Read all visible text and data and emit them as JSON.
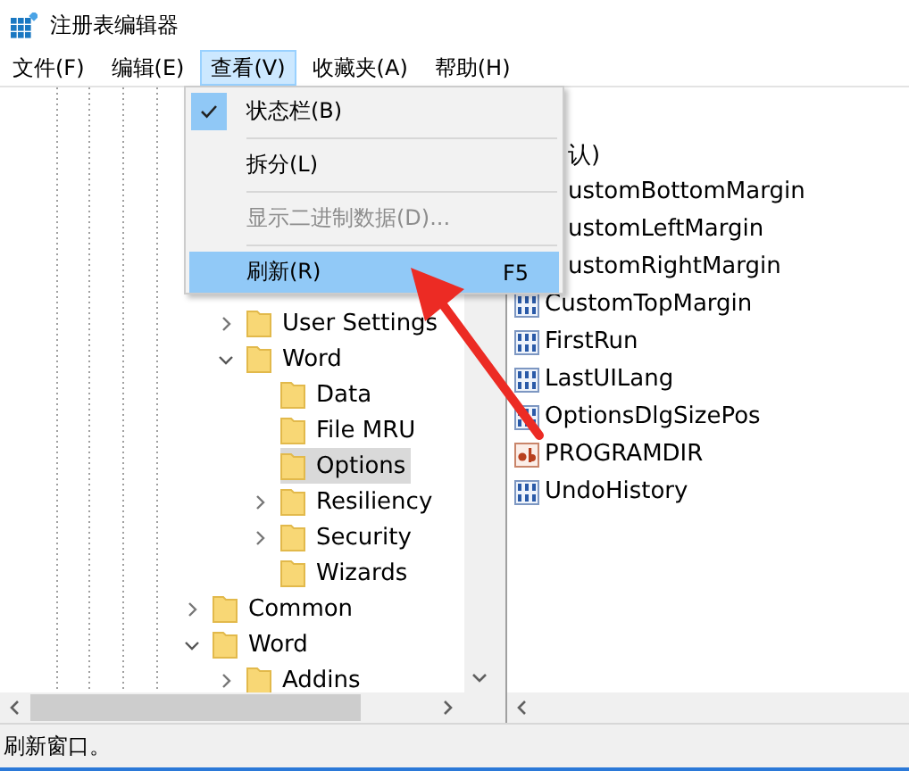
{
  "window": {
    "title": "注册表编辑器"
  },
  "menu_bar": [
    {
      "label": "文件(F)",
      "selected": false
    },
    {
      "label": "编辑(E)",
      "selected": false
    },
    {
      "label": "查看(V)",
      "selected": true
    },
    {
      "label": "收藏夹(A)",
      "selected": false
    },
    {
      "label": "帮助(H)",
      "selected": false
    }
  ],
  "view_menu": {
    "items": [
      {
        "kind": "item",
        "label": "状态栏(B)",
        "checked": true,
        "disabled": false,
        "selected": false
      },
      {
        "kind": "separator"
      },
      {
        "kind": "item",
        "label": "拆分(L)",
        "checked": false,
        "disabled": false,
        "selected": false
      },
      {
        "kind": "separator"
      },
      {
        "kind": "item",
        "label": "显示二进制数据(D)...",
        "checked": false,
        "disabled": true,
        "selected": false
      },
      {
        "kind": "separator"
      },
      {
        "kind": "item",
        "label": "刷新(R)",
        "shortcut": "F5",
        "checked": false,
        "disabled": false,
        "selected": true
      }
    ]
  },
  "tree": {
    "nodes": [
      {
        "label": "User Settings",
        "expanded": false,
        "selected": false
      },
      {
        "label": "Word",
        "expanded": true,
        "selected": false,
        "children": [
          {
            "label": "Data",
            "selected": false
          },
          {
            "label": "File MRU",
            "selected": false
          },
          {
            "label": "Options",
            "selected": true
          },
          {
            "label": "Resiliency",
            "expanded": false,
            "selected": false
          },
          {
            "label": "Security",
            "expanded": false,
            "selected": false
          },
          {
            "label": "Wizards",
            "selected": false
          }
        ]
      }
    ],
    "outer_nodes": [
      {
        "label": "Common",
        "expanded": false,
        "selected": false
      },
      {
        "label": "Word",
        "expanded": true,
        "selected": false,
        "children": [
          {
            "label": "Addins",
            "expanded": false,
            "selected": false
          }
        ]
      }
    ]
  },
  "values": [
    {
      "kind": "covered",
      "name": "认)"
    },
    {
      "kind": "covered",
      "name": "ustomBottomMargin"
    },
    {
      "kind": "covered",
      "name": "ustomLeftMargin"
    },
    {
      "kind": "covered",
      "name": "ustomRightMargin"
    },
    {
      "kind": "binary",
      "name": "CustomTopMargin"
    },
    {
      "kind": "binary",
      "name": "FirstRun"
    },
    {
      "kind": "binary",
      "name": "LastUILang"
    },
    {
      "kind": "binary",
      "name": "OptionsDlgSizePos"
    },
    {
      "kind": "string",
      "name": "PROGRAMDIR"
    },
    {
      "kind": "binary",
      "name": "UndoHistory"
    }
  ],
  "status_bar": {
    "text": "刷新窗口。"
  }
}
